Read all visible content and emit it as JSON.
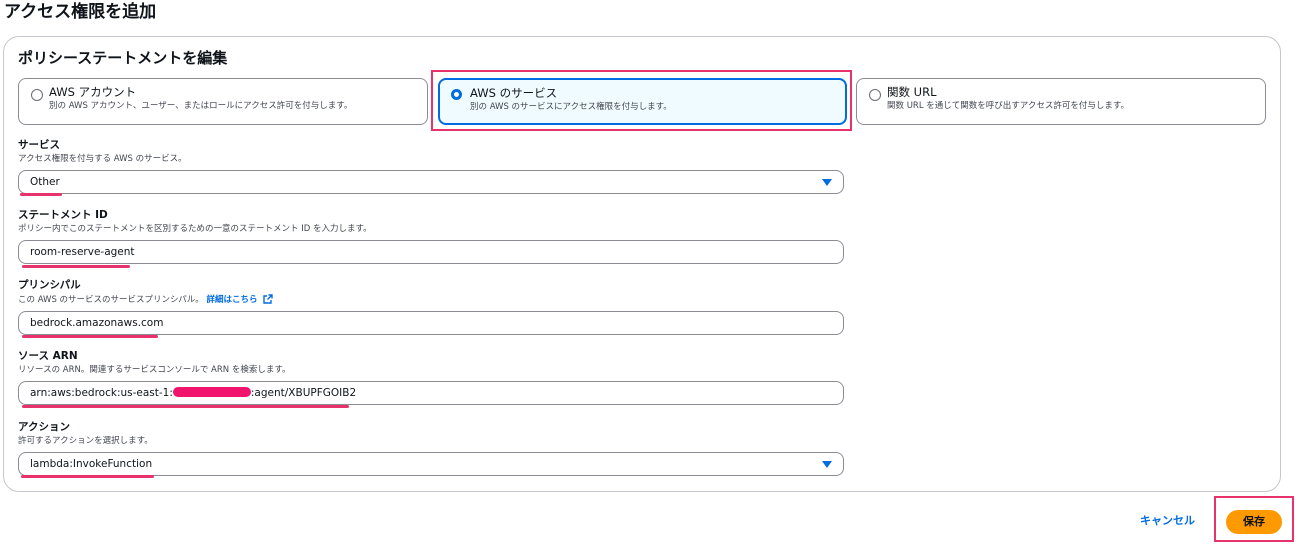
{
  "page": {
    "title": "アクセス権限を追加"
  },
  "policy": {
    "title": "ポリシーステートメントを編集",
    "options": [
      {
        "label": "AWS アカウント",
        "description": "別の AWS アカウント、ユーザー、またはロールにアクセス許可を付与します。",
        "selected": false
      },
      {
        "label": "AWS のサービス",
        "description": "別の AWS のサービスにアクセス権限を付与します。",
        "selected": true
      },
      {
        "label": "関数 URL",
        "description": "関数 URL を通じて関数を呼び出すアクセス許可を付与します。",
        "selected": false
      }
    ]
  },
  "service": {
    "label": "サービス",
    "description": "アクセス権限を付与する AWS のサービス。",
    "value": "Other"
  },
  "statement_id": {
    "label": "ステートメント ID",
    "description": "ポリシー内でこのステートメントを区別するための一意のステートメント ID を入力します。",
    "value": "room-reserve-agent"
  },
  "principal": {
    "label": "プリンシパル",
    "description": "この AWS のサービスのサービスプリンシパル。",
    "link": "詳細はこちら",
    "value": "bedrock.amazonaws.com"
  },
  "source_arn": {
    "label": "ソース ARN",
    "description": "リソースの ARN。関連するサービスコンソールで ARN を検索します。",
    "value_prefix": "arn:aws:bedrock:us-east-1:",
    "value_suffix": ":agent/XBUPFGOIB2"
  },
  "action": {
    "label": "アクション",
    "description": "許可するアクションを選択します。",
    "value": "lambda:InvokeFunction"
  },
  "buttons": {
    "cancel": "キャンセル",
    "save": "保存"
  },
  "colors": {
    "accent": "#006ce0",
    "primary_button": "#ff9900",
    "annotation": "#e8326b"
  }
}
